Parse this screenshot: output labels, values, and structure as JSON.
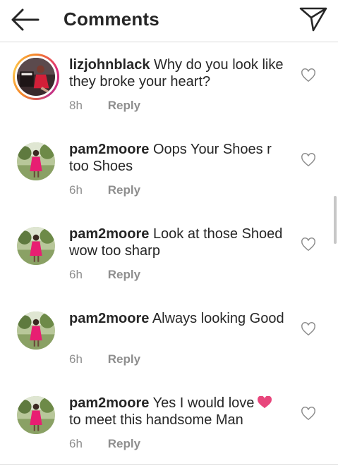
{
  "header": {
    "title": "Comments",
    "back_icon": "arrow-left-icon",
    "send_icon": "paper-plane-icon"
  },
  "comments": [
    {
      "username": "lizjohnblack",
      "text": "Why do you look like they broke your heart?",
      "time": "8h",
      "reply": "Reply"
    },
    {
      "username": "pam2moore",
      "text": "Oops Your Shoes r too Shoes",
      "time": "6h",
      "reply": "Reply"
    },
    {
      "username": "pam2moore",
      "text": "Look at those Shoed wow too sharp",
      "time": "6h",
      "reply": "Reply"
    },
    {
      "username": "pam2moore",
      "text": "Always looking Good",
      "time": "6h",
      "reply": "Reply"
    },
    {
      "username": "pam2moore",
      "text": "Yes I would love",
      "text_after_emoji": "to meet this handsome Man",
      "emoji": "pink-heart-emoji",
      "time": "6h",
      "reply": "Reply"
    }
  ],
  "colors": {
    "text": "#262626",
    "muted": "#8e8e8e",
    "divider": "#dbdbdb",
    "emoji_heart": "#e8467c"
  }
}
